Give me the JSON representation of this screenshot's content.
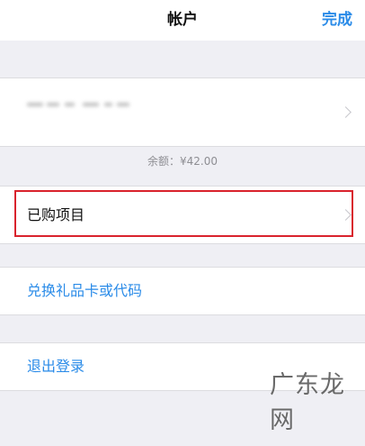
{
  "header": {
    "title": "帐户",
    "done_label": "完成"
  },
  "account": {
    "balance_text": "余额：¥42.00"
  },
  "menu": {
    "purchased_label": "已购项目",
    "redeem_label": "兑换礼品卡或代码",
    "signout_label": "退出登录"
  },
  "watermark": {
    "text": "广东龙网"
  },
  "colors": {
    "accent_blue": "#2a8be8",
    "highlight_red": "#d9232d",
    "background_gray": "#efeff4"
  },
  "icons": {
    "chevron": "chevron-right-icon"
  }
}
